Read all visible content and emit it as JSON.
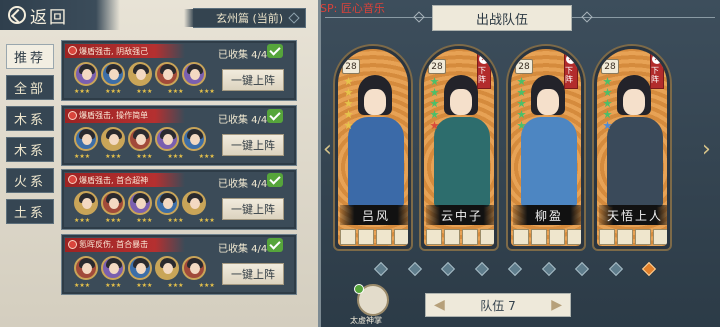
{
  "header": {
    "back_label": "返回",
    "chapter": "玄州篇 (当前)",
    "sp_label": "SP: 匠心音乐",
    "team_title": "出战队伍"
  },
  "tabs": [
    {
      "label": "推荐",
      "active": true
    },
    {
      "label": "全部",
      "active": false
    },
    {
      "label": "木系",
      "active": false
    },
    {
      "label": "木系",
      "active": false
    },
    {
      "label": "火系",
      "active": false
    },
    {
      "label": "土系",
      "active": false
    }
  ],
  "rows": [
    {
      "banner": "爆盾强击, 阴敌强己",
      "collected": "已收集 4/4",
      "button": "一键上阵"
    },
    {
      "banner": "爆盾强击, 操作简单",
      "collected": "已收集 4/4",
      "button": "一键上阵"
    },
    {
      "banner": "爆盾强击, 首合超神",
      "collected": "已收集 4/4",
      "button": "一键上阵"
    },
    {
      "banner": "氪晖反伤, 首合暴击",
      "collected": "已收集 4/4",
      "button": "一键上阵"
    }
  ],
  "cards": [
    {
      "name": "吕风",
      "level": "28",
      "removable": false,
      "body_color": "#3b6aa8",
      "stars": [
        "#e6c34b",
        "#e6c34b",
        "#e6c34b",
        "#e6c34b",
        "#e6c34b"
      ]
    },
    {
      "name": "云中子",
      "level": "28",
      "removable": true,
      "remove_label": "下阵",
      "body_color": "#2d6d6d",
      "stars": [
        "#4bbf6a",
        "#4bbf6a",
        "#4bbf6a",
        "#4bbf6a",
        "#d94a3a"
      ]
    },
    {
      "name": "柳盈",
      "level": "28",
      "removable": true,
      "remove_label": "下阵",
      "body_color": "#4d86c2",
      "stars": [
        "#4bbf6a",
        "#4bbf6a",
        "#4bbf6a",
        "#4bbf6a",
        "#4bbf6a"
      ]
    },
    {
      "name": "天悟上人",
      "level": "28",
      "removable": true,
      "remove_label": "下阵",
      "body_color": "#3a4a5a",
      "stars": [
        "#4bbf6a",
        "#4bbf6a",
        "#4bbf6a",
        "#4bbf6a",
        "#4b8ad9"
      ]
    }
  ],
  "pages": {
    "count": 9,
    "active_index": 8
  },
  "team_selector": "队伍 7",
  "skill_label": "太虚神掌"
}
